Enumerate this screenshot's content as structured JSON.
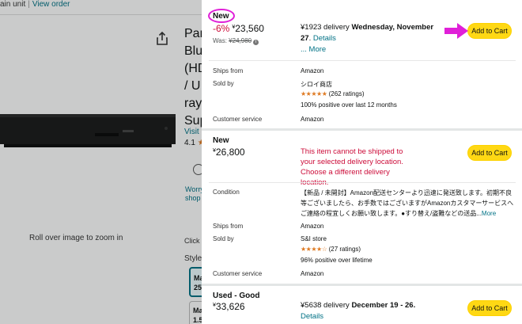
{
  "background": {
    "breadcrumb_prefix": "ain unit",
    "separator": "|",
    "view_order": "View order",
    "title_lines": [
      "Par",
      "Blu",
      "(HD",
      "/ U",
      "ray",
      "Sup"
    ],
    "visit_link": "Visit",
    "rating_value": "4.1",
    "worry_text": "Worry shop",
    "zoom_hint": "Roll over image to zoom in",
    "click_hint": "Click t",
    "style_label": "Style",
    "style_option_1": "Ma 25",
    "style_option_2": "Ma 1.5"
  },
  "offers": [
    {
      "condition": "New",
      "discount": "-6%",
      "price_currency": "¥",
      "price_value": "23,560",
      "was_label": "Was:",
      "was_price": "¥24,980",
      "info_icon": "i",
      "delivery_prefix": "¥1923 delivery",
      "delivery_date": "Wednesday, November 27",
      "delivery_link": "Details",
      "more_link": "... More",
      "add_to_cart": "Add to Cart",
      "ships_from_label": "Ships from",
      "ships_from_value": "Amazon",
      "sold_by_label": "Sold by",
      "seller": "シロイ商店",
      "stars": "★★★★★",
      "ratings": "(262 ratings)",
      "positive": "100% positive over last 12 months",
      "customer_service_label": "Customer service",
      "customer_service_value": "Amazon"
    },
    {
      "condition": "New",
      "price_currency": "¥",
      "price_value": "26,800",
      "unavailable_msg": "This item cannot be shipped to your selected delivery location. Choose a different delivery location.",
      "add_to_cart": "Add to Cart",
      "condition_label": "Condition",
      "condition_desc": "【新品 / 未開封】Amazon配送センターより迅速に発送致します。初期不良等ございましたら、お手数ではございますがAmazonカスタマーサービスへご連絡の程宜しくお願い致します。●すり替え/盗難などの送品...",
      "condition_more": "More",
      "ships_from_label": "Ships from",
      "ships_from_value": "Amazon",
      "sold_by_label": "Sold by",
      "seller": "S&I store",
      "stars": "★★★★☆",
      "ratings": "(27 ratings)",
      "positive": "96% positive over lifetime",
      "customer_service_label": "Customer service",
      "customer_service_value": "Amazon"
    },
    {
      "condition": "Used - Good",
      "price_currency": "¥",
      "price_value": "33,626",
      "delivery_prefix": "¥5638 delivery",
      "delivery_date": "December 19 - 26.",
      "delivery_link": "Details",
      "add_to_cart": "Add to Cart"
    }
  ],
  "colors": {
    "annotation": "#e020d8",
    "add_to_cart": "#ffd814",
    "discount": "#cc0c39",
    "link": "#007185"
  }
}
